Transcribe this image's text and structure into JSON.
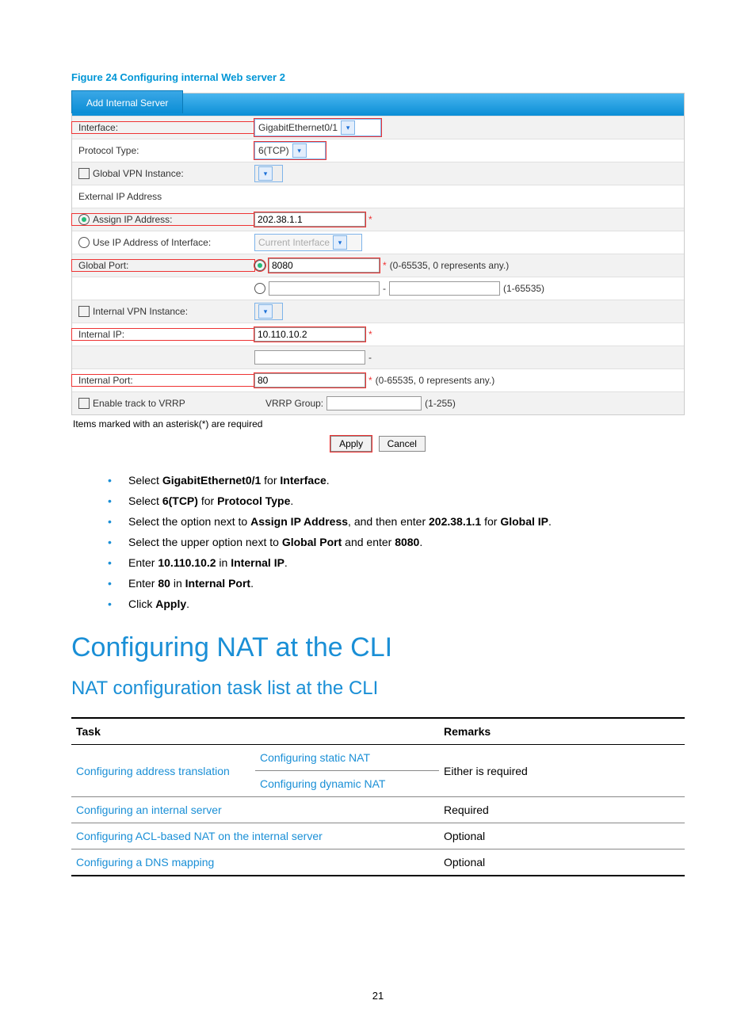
{
  "figure_caption": "Figure 24 Configuring internal Web server 2",
  "form": {
    "tab": "Add Internal Server",
    "labels": {
      "interface": "Interface:",
      "protocol": "Protocol Type:",
      "global_vpn": "Global VPN Instance:",
      "ext_ip_header": "External IP Address",
      "assign_ip": "Assign IP Address:",
      "use_if_ip": "Use IP Address of Interface:",
      "global_port": "Global Port:",
      "internal_vpn": "Internal VPN Instance:",
      "internal_ip": "Internal IP:",
      "internal_port": "Internal Port:",
      "enable_track": "Enable track to VRRP",
      "vrrp_group": "VRRP Group:"
    },
    "values": {
      "interface": "GigabitEthernet0/1",
      "protocol": "6(TCP)",
      "assign_ip": "202.38.1.1",
      "use_if_ip": "Current Interface",
      "global_port": "8080",
      "internal_ip": "10.110.10.2",
      "internal_port": "80"
    },
    "hints": {
      "global_port": "(0-65535, 0 represents any.)",
      "global_port2": "(1-65535)",
      "internal_port": "(0-65535, 0 represents any.)",
      "vrrp": "(1-255)"
    },
    "footnote": "Items marked with an asterisk(*) are required",
    "apply": "Apply",
    "cancel": "Cancel"
  },
  "bullets": [
    {
      "pre": "Select ",
      "b1": "GigabitEthernet0/1",
      "mid": " for ",
      "b2": "Interface",
      "post": "."
    },
    {
      "pre": "Select ",
      "b1": "6(TCP)",
      "mid": " for ",
      "b2": "Protocol Type",
      "post": "."
    },
    {
      "pre": "Select the option next to ",
      "b1": "Assign IP Address",
      "mid": ", and then enter ",
      "b2": "202.38.1.1",
      "mid2": " for ",
      "b3": "Global IP",
      "post": "."
    },
    {
      "pre": "Select the upper option next to ",
      "b1": "Global Port",
      "mid": " and enter ",
      "b2": "8080",
      "post": "."
    },
    {
      "pre": "Enter ",
      "b1": "10.110.10.2",
      "mid": " in ",
      "b2": "Internal IP",
      "post": "."
    },
    {
      "pre": "Enter ",
      "b1": "80",
      "mid": " in ",
      "b2": "Internal Port",
      "post": "."
    },
    {
      "pre": "Click ",
      "b1": "Apply",
      "post": "."
    }
  ],
  "h1": "Configuring NAT at the CLI",
  "h2": "NAT configuration task list at the CLI",
  "table": {
    "th_task": "Task",
    "th_remarks": "Remarks",
    "rows": {
      "r1_task": "Configuring address translation",
      "r1_sub1": "Configuring static NAT",
      "r1_sub2": "Configuring dynamic NAT",
      "r1_remarks": "Either is required",
      "r2_task": "Configuring an internal server",
      "r2_remarks": "Required",
      "r3_task": "Configuring ACL-based NAT on the internal server",
      "r3_remarks": "Optional",
      "r4_task": "Configuring a DNS mapping",
      "r4_remarks": "Optional"
    }
  },
  "page_number": "21"
}
